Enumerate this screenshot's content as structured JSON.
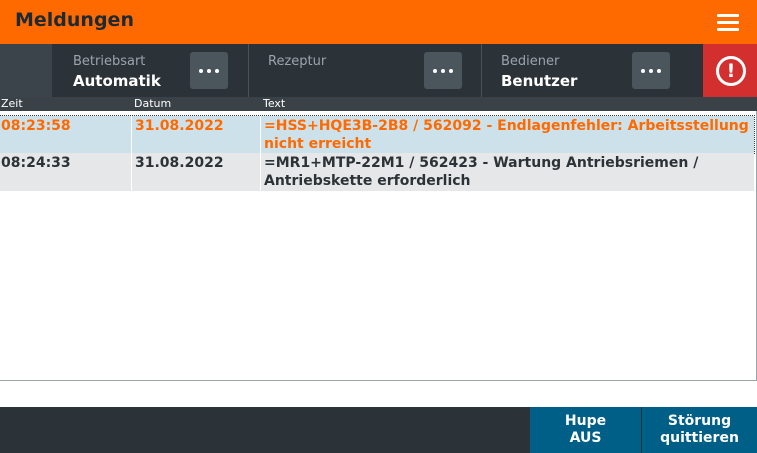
{
  "header": {
    "title": "Meldungen",
    "menu_icon": "hamburger-icon"
  },
  "infobar": {
    "betriebsart": {
      "label": "Betriebsart",
      "value": "Automatik"
    },
    "rezeptur": {
      "label": "Rezeptur",
      "value": ""
    },
    "bediener": {
      "label": "Bediener",
      "value": "Benutzer"
    },
    "alarm_icon": "alert-circle-icon"
  },
  "table": {
    "columns": [
      "Zeit",
      "Datum",
      "Text"
    ],
    "rows": [
      {
        "time": "08:23:58",
        "date": "31.08.2022",
        "text": "=HSS+HQE3B-2B8 / 562092 - Endlagenfehler: Arbeitsstellung nicht erreicht"
      },
      {
        "time": "08:24:33",
        "date": "31.08.2022",
        "text": "=MR1+MTP-22M1 / 562423 - Wartung Antriebsriemen / Antriebskette erforderlich"
      }
    ]
  },
  "bottom": {
    "hupe": [
      "Hupe",
      "AUS"
    ],
    "stoerung": [
      "Störung",
      "quittieren"
    ]
  },
  "colors": {
    "accent": "#ff6a00",
    "dark": "#2c3338",
    "alarm": "#d32f2f",
    "button": "#005f87",
    "selected_row": "#cde1ea"
  }
}
